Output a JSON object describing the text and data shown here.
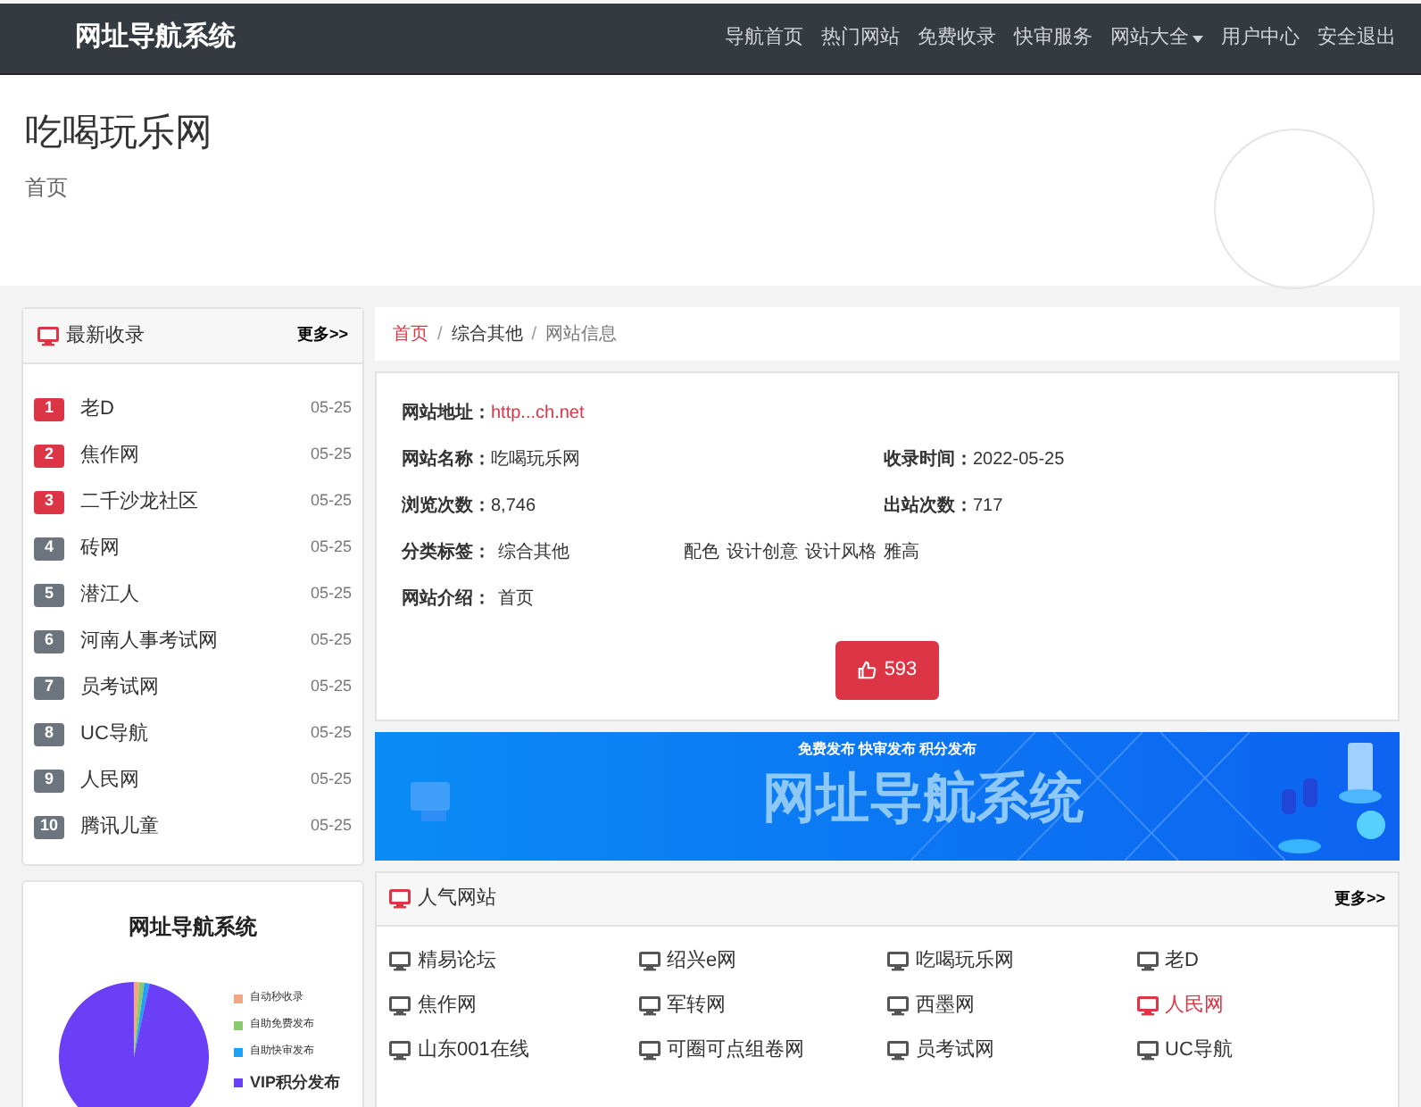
{
  "navbar": {
    "brand": "网址导航系统",
    "links": [
      {
        "label": "导航首页",
        "dropdown": false
      },
      {
        "label": "热门网站",
        "dropdown": false
      },
      {
        "label": "免费收录",
        "dropdown": false
      },
      {
        "label": "快审服务",
        "dropdown": false
      },
      {
        "label": "网站大全",
        "dropdown": true
      },
      {
        "label": "用户中心",
        "dropdown": false
      },
      {
        "label": "安全退出",
        "dropdown": false
      }
    ]
  },
  "header": {
    "title": "吃喝玩乐网",
    "subtitle": "首页"
  },
  "latest": {
    "title": "最新收录",
    "more": "更多>>",
    "items": [
      {
        "rank": "1",
        "name": "老D",
        "date": "05-25",
        "highlighted": true
      },
      {
        "rank": "2",
        "name": "焦作网",
        "date": "05-25",
        "highlighted": true
      },
      {
        "rank": "3",
        "name": "二千沙龙社区",
        "date": "05-25",
        "highlighted": true
      },
      {
        "rank": "4",
        "name": "砖网",
        "date": "05-25",
        "highlighted": false
      },
      {
        "rank": "5",
        "name": "潜江人",
        "date": "05-25",
        "highlighted": false
      },
      {
        "rank": "6",
        "name": "河南人事考试网",
        "date": "05-25",
        "highlighted": false
      },
      {
        "rank": "7",
        "name": "员考试网",
        "date": "05-25",
        "highlighted": false
      },
      {
        "rank": "8",
        "name": "UC导航",
        "date": "05-25",
        "highlighted": false
      },
      {
        "rank": "9",
        "name": "人民网",
        "date": "05-25",
        "highlighted": false
      },
      {
        "rank": "10",
        "name": "腾讯儿童",
        "date": "05-25",
        "highlighted": false
      }
    ]
  },
  "pie": {
    "title": "网址导航系统",
    "legend": [
      {
        "label": "自动秒收录",
        "color": "#f4a582"
      },
      {
        "label": "自助免费发布",
        "color": "#8cc870"
      },
      {
        "label": "自助快审发布",
        "color": "#1ea0f5"
      },
      {
        "label": "VIP积分发布",
        "color": "#6a3ff5"
      }
    ]
  },
  "breadcrumb_separator": "/",
  "breadcrumb": [
    {
      "label": "首页",
      "kind": "link"
    },
    {
      "label": "综合其他",
      "kind": "link"
    },
    {
      "label": "网站信息",
      "kind": "current"
    }
  ],
  "info": {
    "url_label": "网站地址：",
    "url": "http...ch.net",
    "rows": [
      [
        {
          "label": "网站名称：",
          "value": "吃喝玩乐网"
        },
        {
          "label": "收录时间：",
          "value": "2022-05-25"
        }
      ],
      [
        {
          "label": "浏览次数：",
          "value": "8,746"
        },
        {
          "label": "出站次数：",
          "value": "717"
        }
      ]
    ],
    "tags_label": "分类标签：",
    "tags": [
      "综合其他",
      "配色",
      "设计创意",
      "设计风格",
      "雅高"
    ],
    "intro_label": "网站介绍：",
    "intro": "首页",
    "likes": "593"
  },
  "banner": {
    "slogan": "免费发布 快审发布 积分发布",
    "title": "网址导航系统"
  },
  "popular": {
    "title": "人气网站",
    "more": "更多>>",
    "items": [
      {
        "name": "精易论坛",
        "hot": false
      },
      {
        "name": "绍兴e网",
        "hot": false
      },
      {
        "name": "吃喝玩乐网",
        "hot": false
      },
      {
        "name": "老D",
        "hot": false
      },
      {
        "name": "焦作网",
        "hot": false
      },
      {
        "name": "军转网",
        "hot": false
      },
      {
        "name": "西墨网",
        "hot": false
      },
      {
        "name": "人民网",
        "hot": true
      },
      {
        "name": "山东001在线",
        "hot": false
      },
      {
        "name": "可圈可点组卷网",
        "hot": false
      },
      {
        "name": "员考试网",
        "hot": false
      },
      {
        "name": "UC导航",
        "hot": false
      }
    ]
  }
}
